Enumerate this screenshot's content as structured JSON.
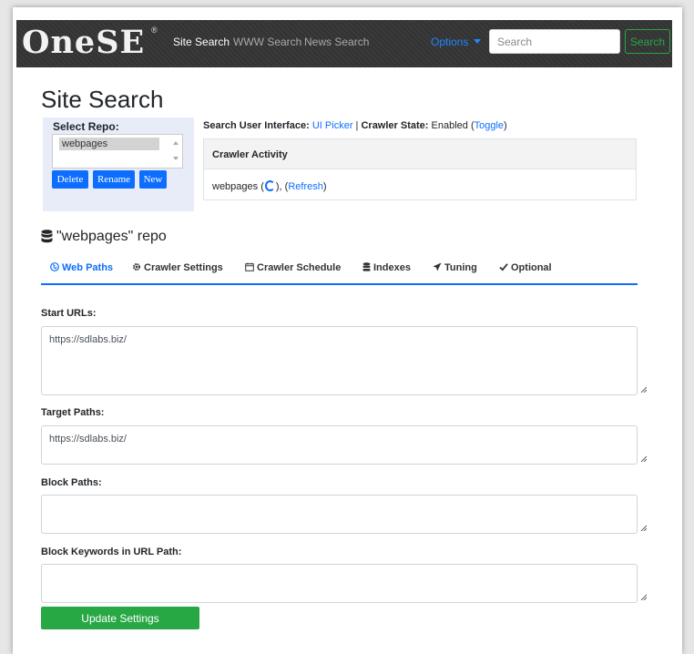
{
  "navbar": {
    "logo": "OneSE",
    "logo_mark": "®",
    "links": [
      "Site Search",
      "WWW Search",
      "News Search"
    ],
    "options_label": "Options",
    "search_placeholder": "Search",
    "search_button": "Search"
  },
  "page_title": "Site Search",
  "repo_panel": {
    "label": "Select Repo:",
    "selected": "webpages",
    "buttons": [
      "Delete",
      "Rename",
      "New"
    ]
  },
  "info": {
    "ui_label": "Search User Interface",
    "ui_link": "UI Picker",
    "separator": "|",
    "state_label": "Crawler State",
    "state_value": "Enabled",
    "toggle_link": "Toggle"
  },
  "activity": {
    "title": "Crawler Activity",
    "repo_name": "webpages",
    "refresh_link": "Refresh"
  },
  "repo_heading": "\"webpages\" repo",
  "tabs": [
    {
      "label": "Web Paths",
      "icon": "globe-icon",
      "active": true
    },
    {
      "label": "Crawler Settings",
      "icon": "gear-icon",
      "active": false
    },
    {
      "label": "Crawler Schedule",
      "icon": "calendar-icon",
      "active": false
    },
    {
      "label": "Indexes",
      "icon": "database-icon",
      "active": false
    },
    {
      "label": "Tuning",
      "icon": "send-icon",
      "active": false
    },
    {
      "label": "Optional",
      "icon": "check-icon",
      "active": false
    }
  ],
  "form": {
    "start_urls_label": "Start URLs:",
    "start_urls_value": "https://sdlabs.biz/",
    "target_paths_label": "Target Paths:",
    "target_paths_value": "https://sdlabs.biz/",
    "block_paths_label": "Block Paths:",
    "block_paths_value": "",
    "block_keywords_label": "Block Keywords in URL Path:",
    "block_keywords_value": "",
    "submit_label": "Update Settings"
  },
  "colors": {
    "primary": "#0d6efd",
    "success": "#28a745",
    "navbar": "#333333"
  }
}
